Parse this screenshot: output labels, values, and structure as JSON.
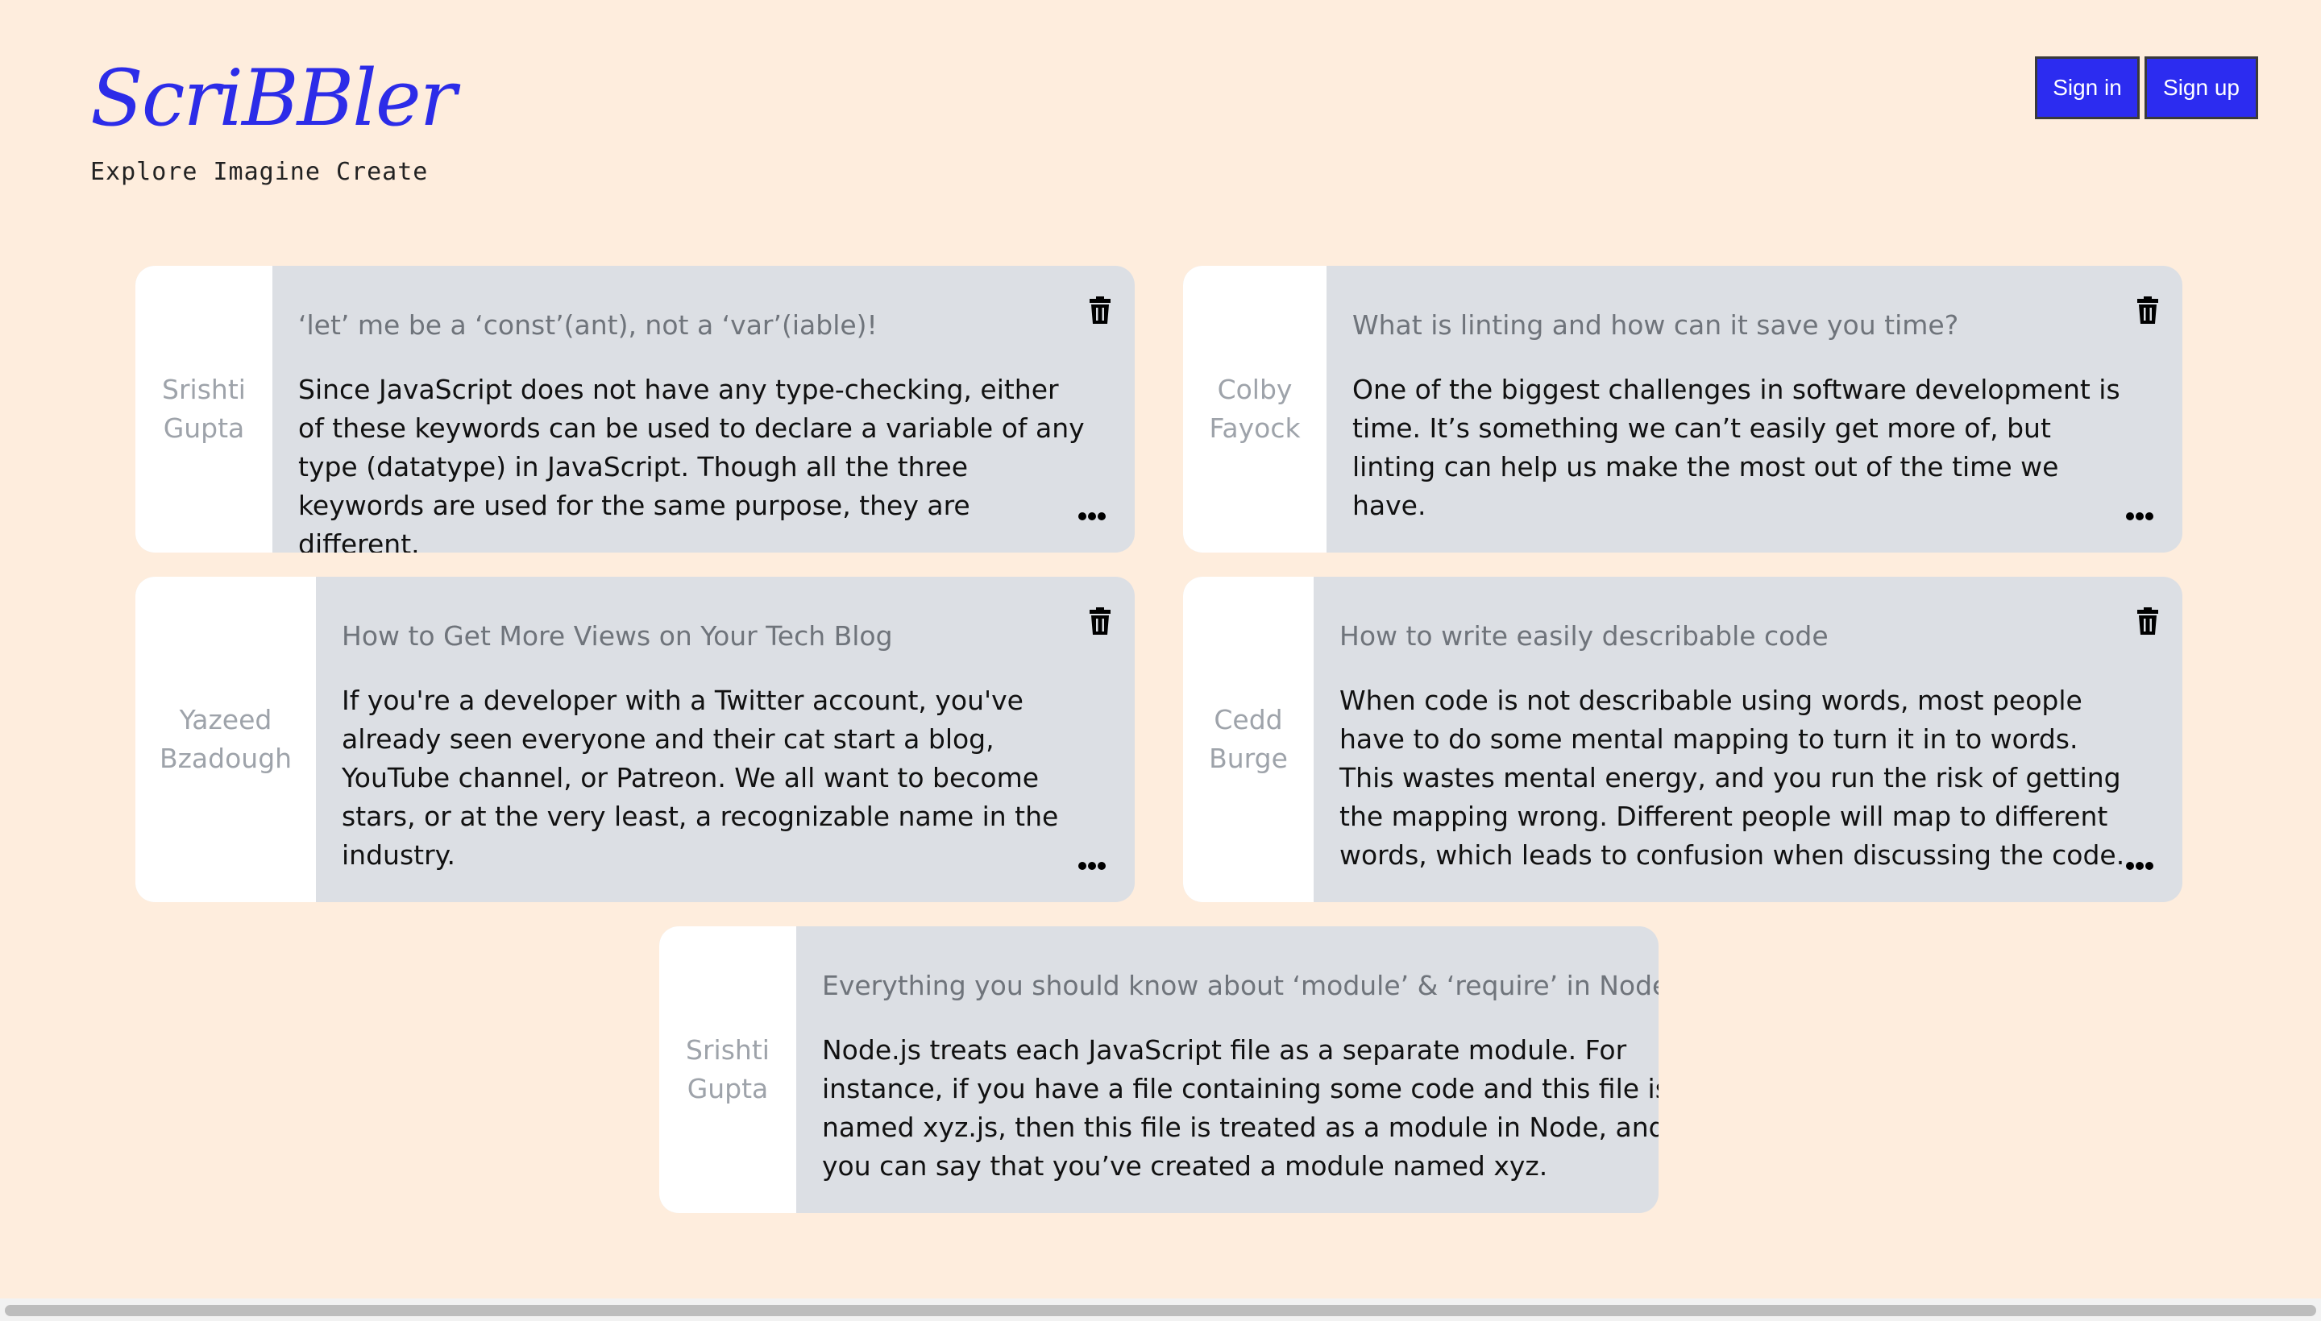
{
  "header": {
    "logo": "ScriBBler",
    "tagline": "Explore Imagine Create"
  },
  "auth": {
    "sign_in": "Sign in",
    "sign_up": "Sign up"
  },
  "posts": [
    {
      "author": "Srishti Gupta",
      "title": "‘let’ me be a ‘const’(ant), not a ‘var’(iable)!",
      "body": "Since JavaScript does not have any type-checking, either of these keywords can be used to declare a variable of any type (datatype) in JavaScript. Though all the three keywords are used for the same purpose, they are different."
    },
    {
      "author": "Colby Fayock",
      "title": "What is linting and how can it save you time?",
      "body": "One of the biggest challenges in software development is time. It’s something we can’t easily get more of, but linting can help us make the most out of the time we have."
    },
    {
      "author": "Yazeed Bzadough",
      "title": "How to Get More Views on Your Tech Blog",
      "body": "If you're a developer with a Twitter account, you've already seen everyone and their cat start a blog, YouTube channel, or Patreon. We all want to become stars, or at the very least, a recognizable name in the industry."
    },
    {
      "author": "Cedd Burge",
      "title": "How to write easily describable code",
      "body": "When code is not describable using words, most people have to do some mental mapping to turn it in to words. This wastes mental energy, and you run the risk of getting the mapping wrong. Different people will map to different words, which leads to confusion when discussing the code."
    },
    {
      "author": "Srishti Gupta",
      "title": "Everything you should know about ‘module’ & ‘require’ in Node.js",
      "body": "Node.js treats each JavaScript file as a separate module. For instance, if you have a file containing some code and this file is named xyz.js, then this file is treated as a module in Node, and you can say that you’ve created a module named xyz."
    }
  ]
}
